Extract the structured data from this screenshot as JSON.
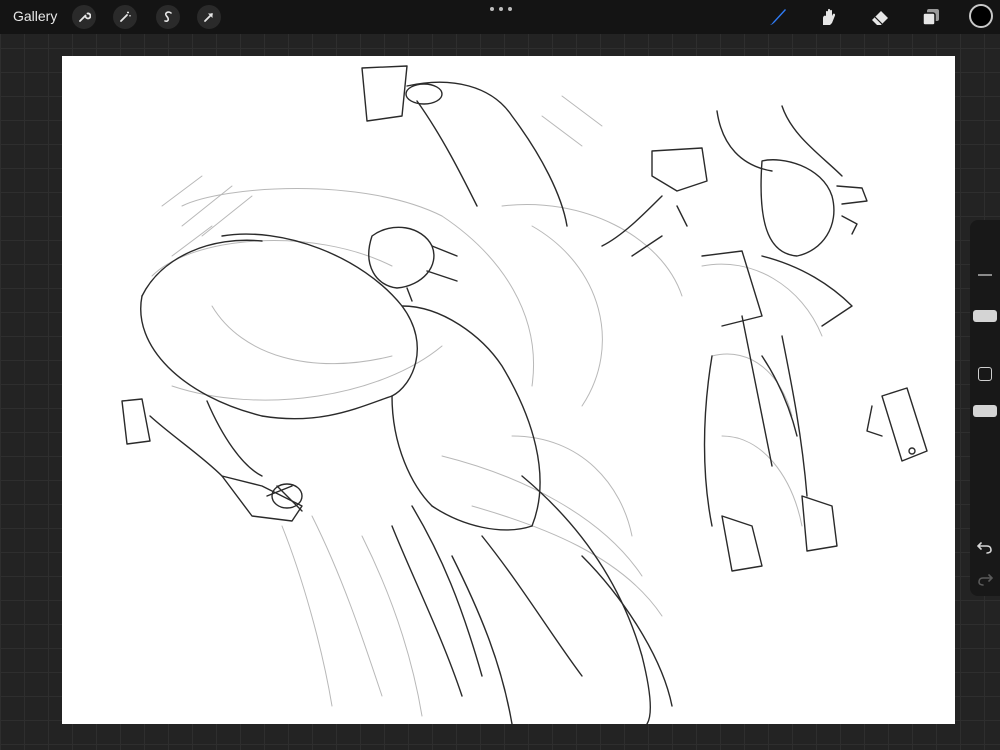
{
  "app": {
    "gallery_label": "Gallery"
  },
  "toolbar_left": [
    {
      "name": "actions",
      "icon": "wrench-icon"
    },
    {
      "name": "adjustments",
      "icon": "magic-wand-icon"
    },
    {
      "name": "selection",
      "icon": "selection-s-icon"
    },
    {
      "name": "transform",
      "icon": "arrow-cursor-icon"
    }
  ],
  "toolbar_right": [
    {
      "name": "brush",
      "icon": "brush-icon",
      "active": true
    },
    {
      "name": "smudge",
      "icon": "smudge-finger-icon",
      "active": false
    },
    {
      "name": "eraser",
      "icon": "eraser-icon",
      "active": false
    },
    {
      "name": "layers",
      "icon": "layers-icon",
      "active": false
    }
  ],
  "colors": {
    "accent": "#2f7bf5",
    "current_color": "#000000",
    "toolbar_bg": "#141414",
    "canvas_bg": "#ffffff",
    "workspace_bg": "#232323"
  },
  "sidebar": {
    "controls": [
      "brush-size-slider",
      "modify-button",
      "opacity-slider",
      "undo-button",
      "redo-button"
    ]
  }
}
